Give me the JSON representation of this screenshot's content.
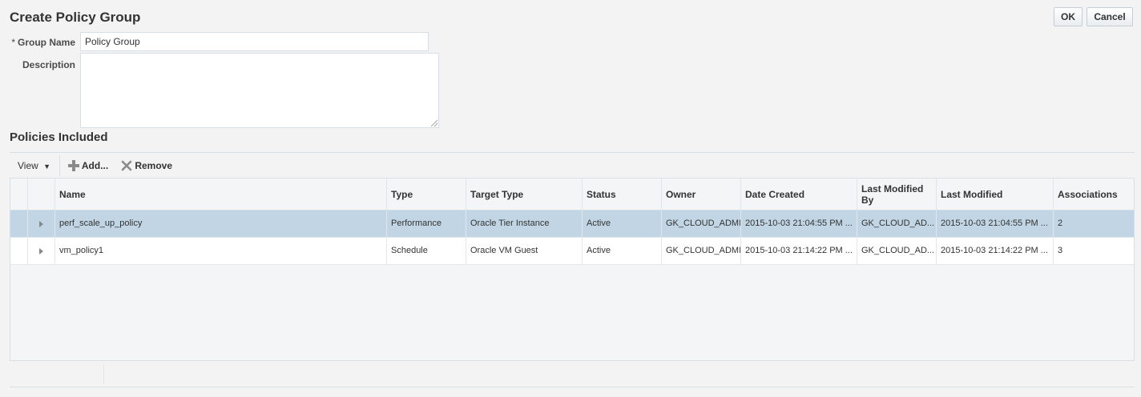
{
  "page": {
    "title": "Create Policy Group"
  },
  "actions": {
    "ok_label": "OK",
    "cancel_label": "Cancel"
  },
  "form": {
    "group_name_label": "Group Name",
    "required_marker": "*",
    "group_name_value": "Policy Group",
    "description_label": "Description",
    "description_value": ""
  },
  "policies": {
    "title": "Policies Included",
    "toolbar": {
      "view_label": "View",
      "add_label": "Add...",
      "remove_label": "Remove"
    },
    "columns": [
      "Name",
      "Type",
      "Target Type",
      "Status",
      "Owner",
      "Date Created",
      "Last Modified By",
      "Last Modified",
      "Associations"
    ],
    "rows": [
      {
        "name": "perf_scale_up_policy",
        "type": "Performance",
        "target_type": "Oracle Tier Instance",
        "status": "Active",
        "owner": "GK_CLOUD_ADMIN",
        "date_created": "2015-10-03 21:04:55 PM ...",
        "last_modified_by": "GK_CLOUD_AD...",
        "last_modified": "2015-10-03 21:04:55 PM ...",
        "associations": "2",
        "selected": true
      },
      {
        "name": "vm_policy1",
        "type": "Schedule",
        "target_type": "Oracle VM Guest",
        "status": "Active",
        "owner": "GK_CLOUD_ADMIN",
        "date_created": "2015-10-03 21:14:22 PM ...",
        "last_modified_by": "GK_CLOUD_AD...",
        "last_modified": "2015-10-03 21:14:22 PM ...",
        "associations": "3",
        "selected": false
      }
    ]
  },
  "colors": {
    "selected_row": "#c1d5e4",
    "border": "#d6dfe6",
    "background": "#f3f3f3"
  }
}
